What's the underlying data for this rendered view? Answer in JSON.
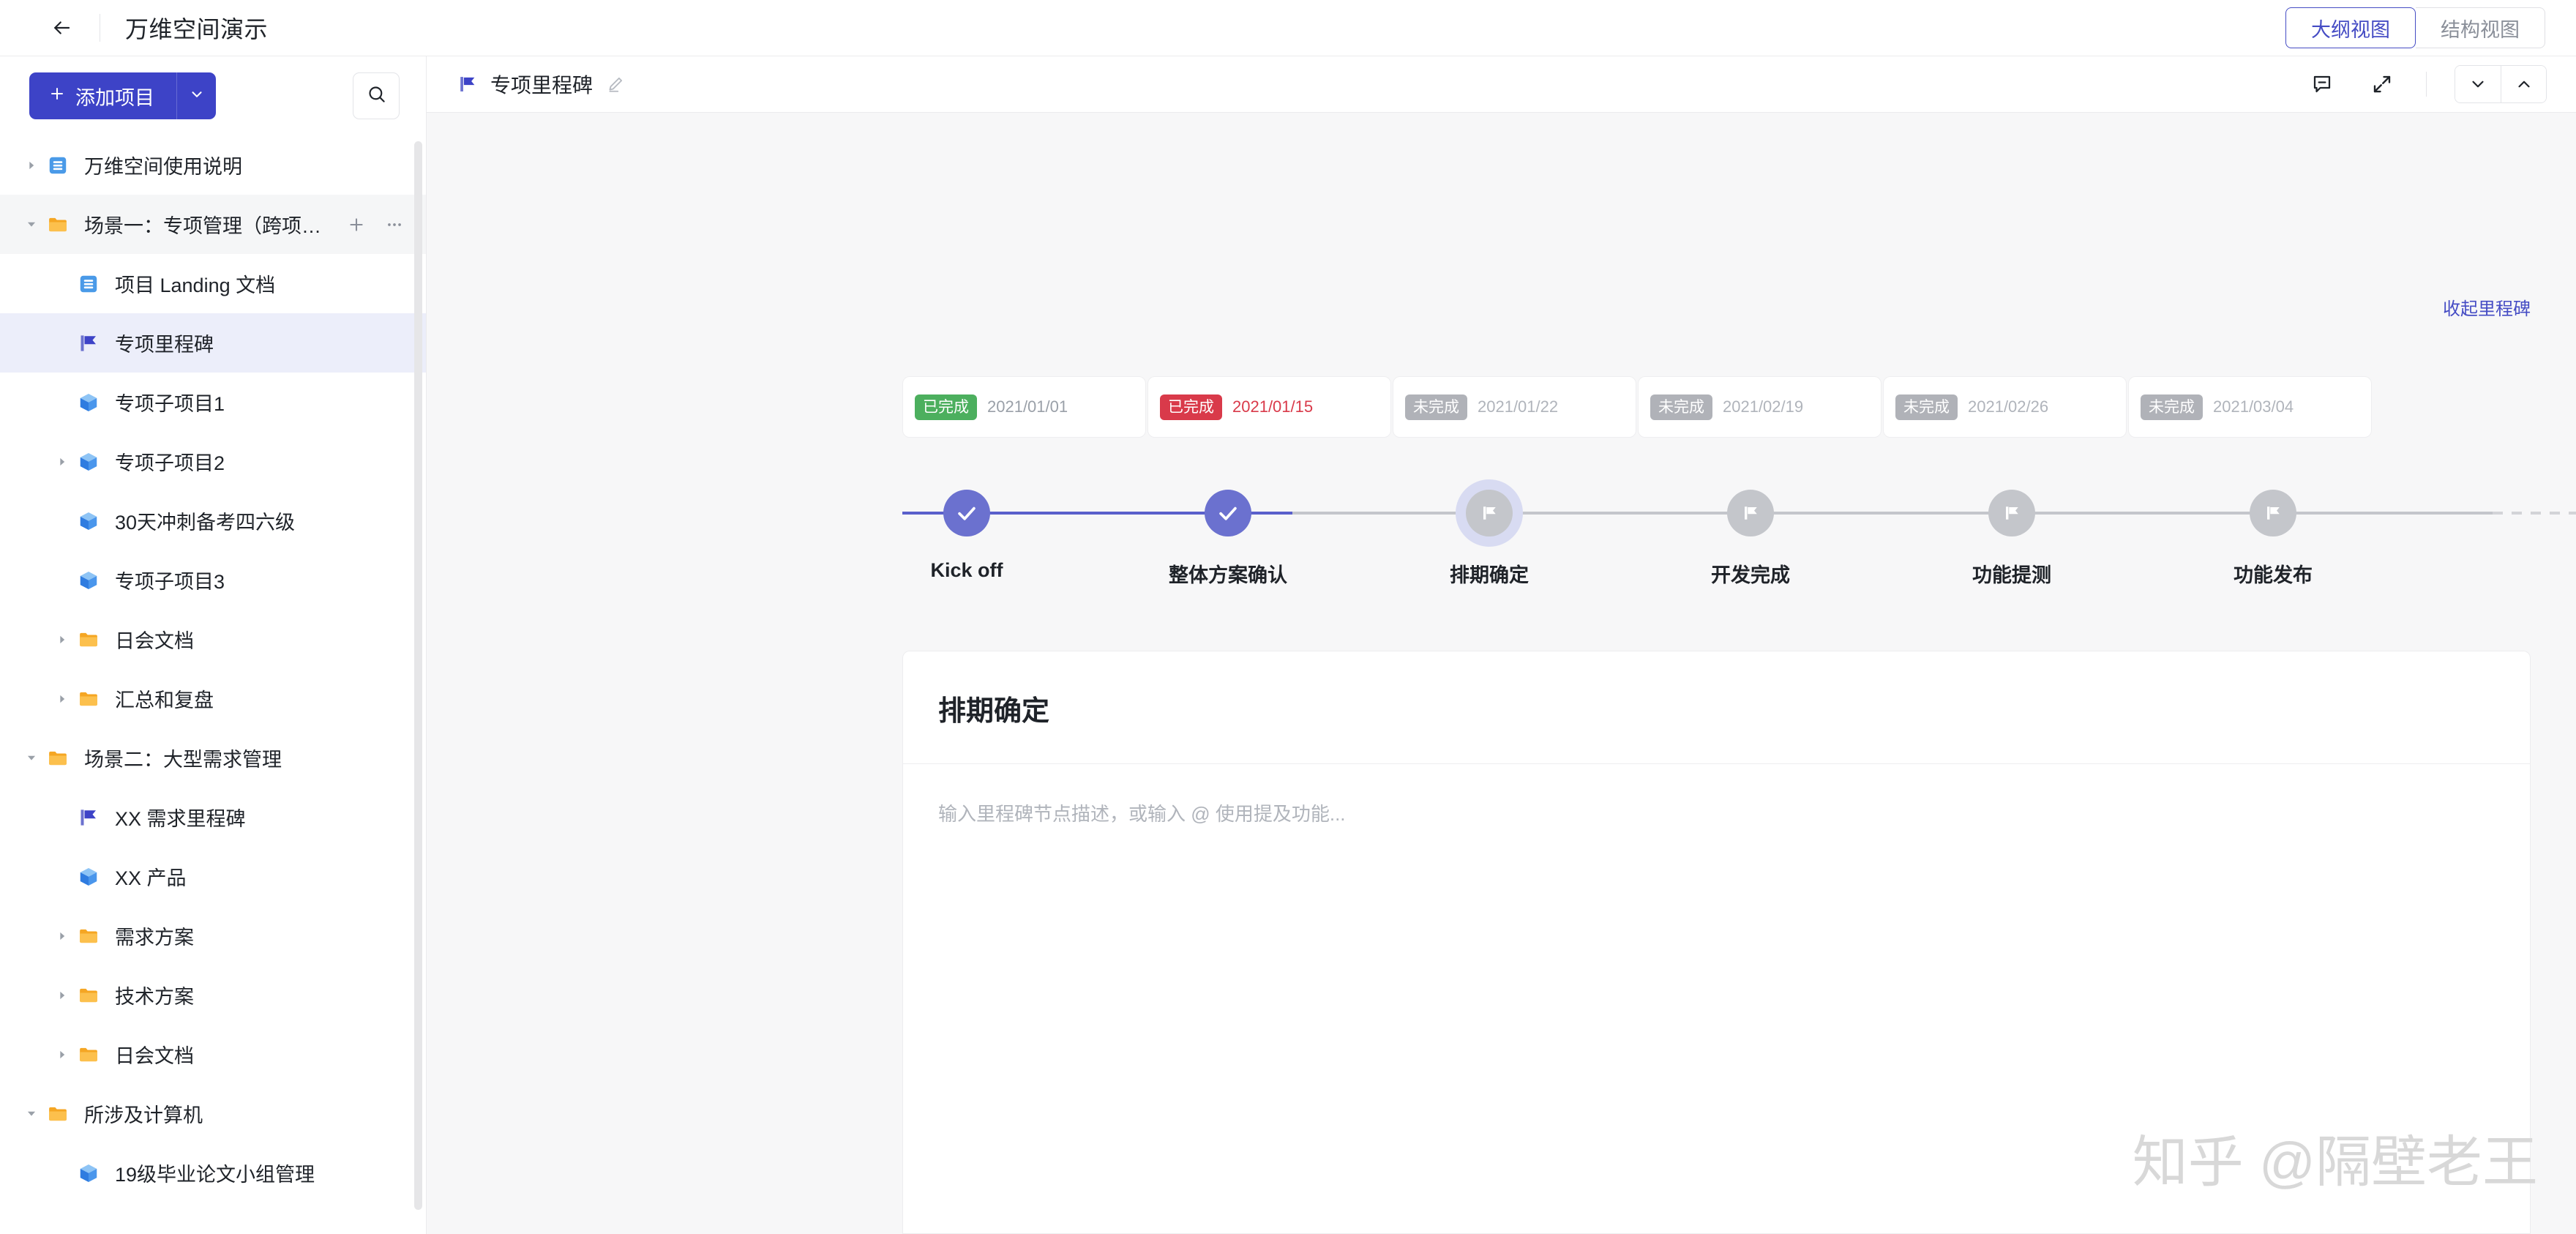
{
  "topbar": {
    "back_icon": "arrow-left-icon",
    "title": "万维空间演示",
    "views": [
      {
        "label": "大纲视图",
        "active": true
      },
      {
        "label": "结构视图",
        "active": false
      }
    ]
  },
  "sidebar": {
    "add_button_label": "添加项目",
    "add_button_plus": "+",
    "add_caret_icon": "chevron-down-icon",
    "search_icon": "search-icon",
    "tree": [
      {
        "label": "万维空间使用说明",
        "icon": "doc-icon",
        "indent": 0,
        "twisty": "collapsed",
        "state": "normal"
      },
      {
        "label": "场景一：专项管理（跨项目）",
        "icon": "folder-icon",
        "indent": 0,
        "twisty": "expanded",
        "state": "hovered",
        "actions": [
          "plus-icon",
          "more-icon"
        ]
      },
      {
        "label": "项目 Landing 文档",
        "icon": "doc-icon",
        "indent": 1,
        "twisty": "none",
        "state": "normal"
      },
      {
        "label": "专项里程碑",
        "icon": "flag-icon",
        "indent": 1,
        "twisty": "none",
        "state": "selected"
      },
      {
        "label": "专项子项目1",
        "icon": "cube-icon",
        "indent": 1,
        "twisty": "none",
        "state": "normal"
      },
      {
        "label": "专项子项目2",
        "icon": "cube-icon",
        "indent": 1,
        "twisty": "collapsed",
        "state": "normal"
      },
      {
        "label": "30天冲刺备考四六级",
        "icon": "cube-icon",
        "indent": 1,
        "twisty": "none",
        "state": "normal"
      },
      {
        "label": "专项子项目3",
        "icon": "cube-icon",
        "indent": 1,
        "twisty": "none",
        "state": "normal"
      },
      {
        "label": "日会文档",
        "icon": "folder-icon",
        "indent": 1,
        "twisty": "collapsed",
        "state": "normal"
      },
      {
        "label": "汇总和复盘",
        "icon": "folder-icon",
        "indent": 1,
        "twisty": "collapsed",
        "state": "normal"
      },
      {
        "label": "场景二：大型需求管理",
        "icon": "folder-icon",
        "indent": 0,
        "twisty": "expanded",
        "state": "normal"
      },
      {
        "label": "XX 需求里程碑",
        "icon": "flag-icon",
        "indent": 1,
        "twisty": "none",
        "state": "normal"
      },
      {
        "label": "XX 产品",
        "icon": "cube-icon",
        "indent": 1,
        "twisty": "none",
        "state": "normal"
      },
      {
        "label": "需求方案",
        "icon": "folder-icon",
        "indent": 1,
        "twisty": "collapsed",
        "state": "normal"
      },
      {
        "label": "技术方案",
        "icon": "folder-icon",
        "indent": 1,
        "twisty": "collapsed",
        "state": "normal"
      },
      {
        "label": "日会文档",
        "icon": "folder-icon",
        "indent": 1,
        "twisty": "collapsed",
        "state": "normal"
      },
      {
        "label": "所涉及计算机",
        "icon": "folder-icon",
        "indent": 0,
        "twisty": "expanded",
        "state": "normal"
      },
      {
        "label": "19级毕业论文小组管理",
        "icon": "cube-icon",
        "indent": 1,
        "twisty": "none",
        "state": "normal"
      }
    ]
  },
  "main": {
    "header": {
      "flag_icon": "flag-icon",
      "title": "专项里程碑",
      "edit_icon": "pencil-icon",
      "comment_icon": "comment-minus-icon",
      "expand_icon": "expand-icon",
      "prev_icon": "chevron-down-icon",
      "next_icon": "chevron-up-icon"
    },
    "collapse_link": "收起里程碑",
    "milestones": [
      {
        "label": "Kick off",
        "status": "已完成",
        "date": "2021/01/01",
        "status_color": "#4caf5e",
        "date_color": "#9aa0a8",
        "node": "done"
      },
      {
        "label": "整体方案确认",
        "status": "已完成",
        "date": "2021/01/15",
        "status_color": "#d93a4a",
        "date_color": "#d93a4a",
        "node": "done"
      },
      {
        "label": "排期确定",
        "status": "未完成",
        "date": "2021/01/22",
        "status_color": "#b0b2b8",
        "date_color": "#b0b4bb",
        "node": "todo-active"
      },
      {
        "label": "开发完成",
        "status": "未完成",
        "date": "2021/02/19",
        "status_color": "#b0b2b8",
        "date_color": "#b0b4bb",
        "node": "todo"
      },
      {
        "label": "功能提测",
        "status": "未完成",
        "date": "2021/02/26",
        "status_color": "#b0b2b8",
        "date_color": "#b0b4bb",
        "node": "todo"
      },
      {
        "label": "功能发布",
        "status": "未完成",
        "date": "2021/03/04",
        "status_color": "#b0b2b8",
        "date_color": "#b0b4bb",
        "node": "todo"
      }
    ],
    "add_milestone_icon": "plus-icon",
    "detail": {
      "title": "排期确定",
      "description_placeholder": "输入里程碑节点描述，或输入 @ 使用提及功能..."
    }
  },
  "watermark": "知乎 @隔壁老王",
  "colors": {
    "primary": "#3d43c7",
    "node_done": "#6b71cf",
    "node_todo": "#c4c6cb",
    "active_ring": "#d8dbf2",
    "track_done": "#5a60cb",
    "track_todo": "#c4c6cb",
    "selected_row": "#eceefa",
    "canvas": "#f7f7f8"
  }
}
